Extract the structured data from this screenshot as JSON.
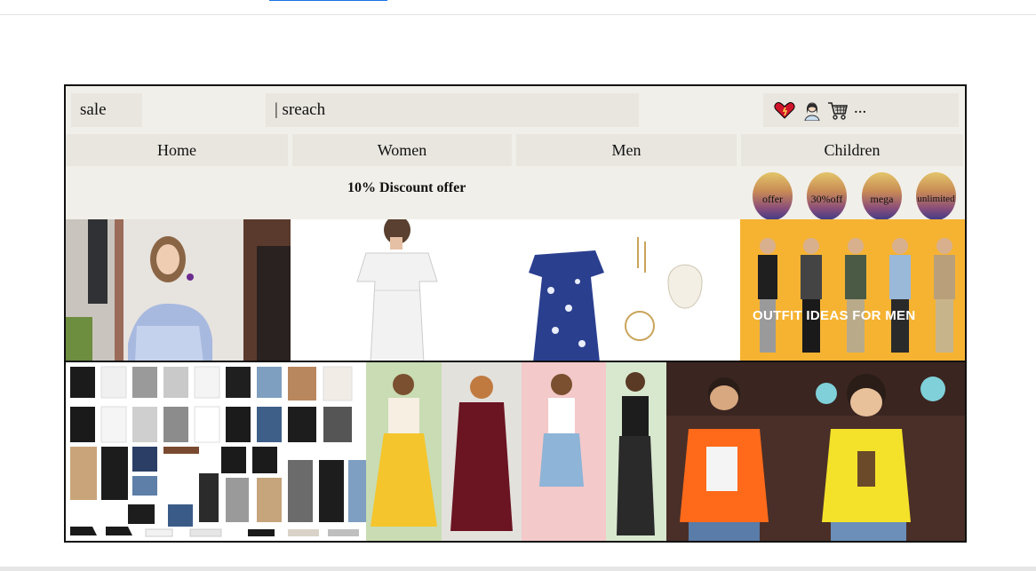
{
  "header": {
    "sale_label": "sale",
    "search_placeholder": "| sreach",
    "icons": [
      "heart-icon",
      "user-icon",
      "cart-icon"
    ],
    "more_label": "..."
  },
  "nav": {
    "items": [
      {
        "label": "Home"
      },
      {
        "label": "Women"
      },
      {
        "label": "Men"
      },
      {
        "label": "Children"
      }
    ]
  },
  "promo": {
    "offer_text": "10% Discount offer",
    "badges": [
      "offer",
      "30%off",
      "mega",
      "unlimited"
    ]
  },
  "gallery": {
    "mens_banner_text": "OUTFIT IDEAS FOR MEN"
  },
  "colors": {
    "panel_bg": "#f1efe9",
    "box_bg": "#e9e6df",
    "border": "#111111"
  }
}
